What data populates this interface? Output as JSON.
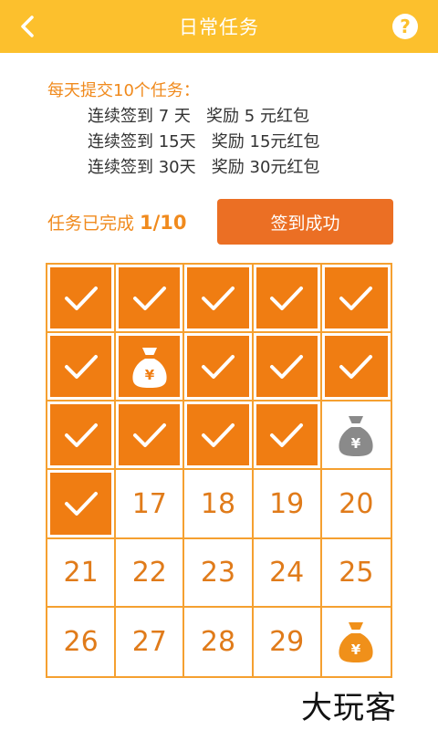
{
  "header": {
    "title": "日常任务",
    "help": "?"
  },
  "rules": {
    "heading": "每天提交10个任务：",
    "rows": [
      "连续签到 7 天   奖励 5 元红包",
      "连续签到 15天   奖励 15元红包",
      "连续签到 30天   奖励 30元红包"
    ]
  },
  "progress": {
    "label": "任务已完成",
    "count": "1/10"
  },
  "signin_button": "签到成功",
  "calendar": [
    {
      "state": "done"
    },
    {
      "state": "done"
    },
    {
      "state": "done"
    },
    {
      "state": "done"
    },
    {
      "state": "done"
    },
    {
      "state": "done"
    },
    {
      "state": "bag-white"
    },
    {
      "state": "done"
    },
    {
      "state": "done"
    },
    {
      "state": "done"
    },
    {
      "state": "done"
    },
    {
      "state": "done"
    },
    {
      "state": "done"
    },
    {
      "state": "done"
    },
    {
      "state": "bag-gray"
    },
    {
      "state": "done"
    },
    {
      "day": "17"
    },
    {
      "day": "18"
    },
    {
      "day": "19"
    },
    {
      "day": "20"
    },
    {
      "day": "21"
    },
    {
      "day": "22"
    },
    {
      "day": "23"
    },
    {
      "day": "24"
    },
    {
      "day": "25"
    },
    {
      "day": "26"
    },
    {
      "day": "27"
    },
    {
      "day": "28"
    },
    {
      "day": "29"
    },
    {
      "state": "bag-orange"
    }
  ],
  "colors": {
    "accent": "#fcc02d",
    "done_fill": "#f07d12",
    "button": "#eb6f24"
  },
  "watermark": "大玩客"
}
